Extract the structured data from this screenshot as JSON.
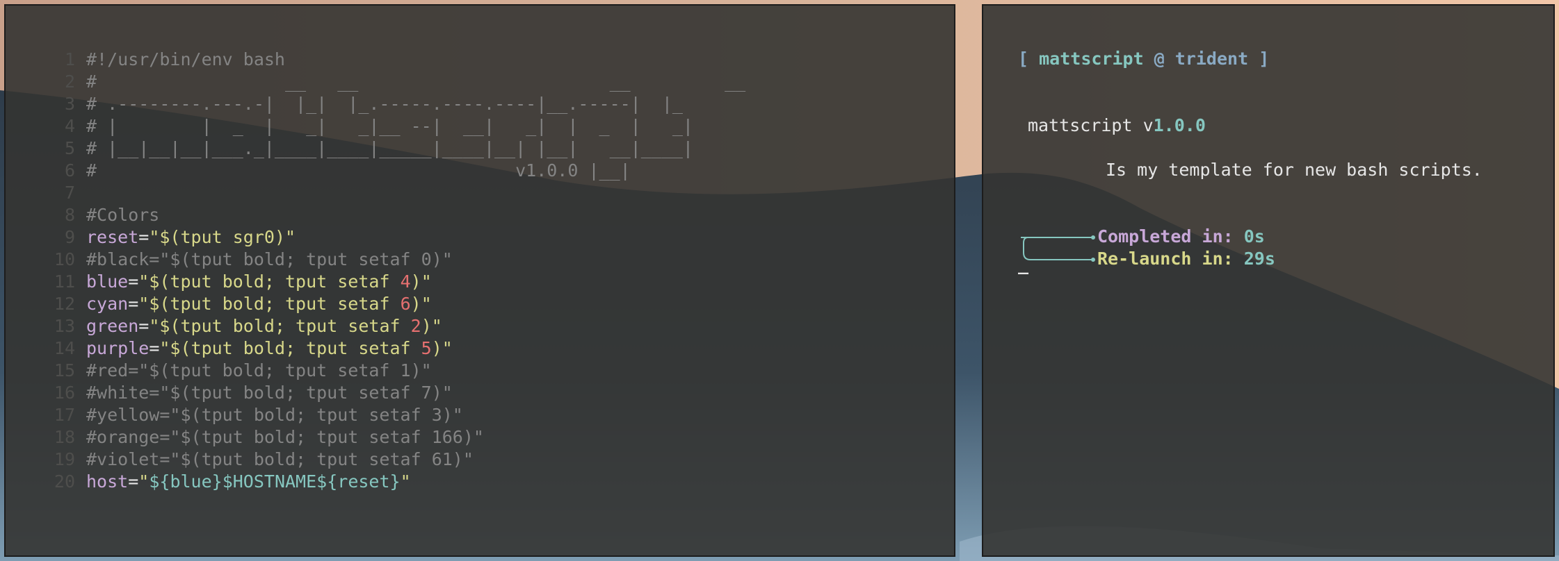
{
  "colors": {
    "terminal_bg": "#343432",
    "comment": "#848484",
    "variable": "#c8a8d8",
    "string": "#d8d88a",
    "number": "#e67070",
    "teal": "#86c7c0",
    "bracket": "#8aaac4",
    "text": "#e6e6e6"
  },
  "editor": {
    "lines": [
      {
        "n": "1",
        "segs": [
          {
            "t": "#!/usr/bin/env bash",
            "c": "com"
          }
        ]
      },
      {
        "n": "2",
        "segs": [
          {
            "t": "#                  __   __                        __         __",
            "c": "com"
          }
        ]
      },
      {
        "n": "3",
        "segs": [
          {
            "t": "# .--------.---.-|  |_|  |_.-----.----.----|__.-----|  |_",
            "c": "com"
          }
        ]
      },
      {
        "n": "4",
        "segs": [
          {
            "t": "# |        |  _  |   _|   _|__ --|  __|   _|  |  _  |   _|",
            "c": "com"
          }
        ]
      },
      {
        "n": "5",
        "segs": [
          {
            "t": "# |__|__|__|___._|____|____|_____|____|__| |__|   __|____|",
            "c": "com"
          }
        ]
      },
      {
        "n": "6",
        "segs": [
          {
            "t": "#                                        v1.0.0 |__|",
            "c": "com"
          }
        ]
      },
      {
        "n": "7",
        "segs": []
      },
      {
        "n": "8",
        "segs": [
          {
            "t": "#Colors",
            "c": "com"
          }
        ]
      },
      {
        "n": "9",
        "segs": [
          {
            "t": "reset",
            "c": "var"
          },
          {
            "t": "=",
            "c": "txt"
          },
          {
            "t": "\"$(tput sgr0)\"",
            "c": "str"
          }
        ]
      },
      {
        "n": "10",
        "segs": [
          {
            "t": "#black=\"$(tput bold; tput setaf 0)\"",
            "c": "com"
          }
        ]
      },
      {
        "n": "11",
        "segs": [
          {
            "t": "blue",
            "c": "var"
          },
          {
            "t": "=",
            "c": "txt"
          },
          {
            "t": "\"$(tput bold; tput setaf ",
            "c": "str"
          },
          {
            "t": "4",
            "c": "num"
          },
          {
            "t": ")\"",
            "c": "str"
          }
        ]
      },
      {
        "n": "12",
        "segs": [
          {
            "t": "cyan",
            "c": "var"
          },
          {
            "t": "=",
            "c": "txt"
          },
          {
            "t": "\"$(tput bold; tput setaf ",
            "c": "str"
          },
          {
            "t": "6",
            "c": "num"
          },
          {
            "t": ")\"",
            "c": "str"
          }
        ]
      },
      {
        "n": "13",
        "segs": [
          {
            "t": "green",
            "c": "var"
          },
          {
            "t": "=",
            "c": "txt"
          },
          {
            "t": "\"$(tput bold; tput setaf ",
            "c": "str"
          },
          {
            "t": "2",
            "c": "num"
          },
          {
            "t": ")\"",
            "c": "str"
          }
        ]
      },
      {
        "n": "14",
        "segs": [
          {
            "t": "purple",
            "c": "var"
          },
          {
            "t": "=",
            "c": "txt"
          },
          {
            "t": "\"$(tput bold; tput setaf ",
            "c": "str"
          },
          {
            "t": "5",
            "c": "num"
          },
          {
            "t": ")\"",
            "c": "str"
          }
        ]
      },
      {
        "n": "15",
        "segs": [
          {
            "t": "#red=\"$(tput bold; tput setaf 1)\"",
            "c": "com"
          }
        ]
      },
      {
        "n": "16",
        "segs": [
          {
            "t": "#white=\"$(tput bold; tput setaf 7)\"",
            "c": "com"
          }
        ]
      },
      {
        "n": "17",
        "segs": [
          {
            "t": "#yellow=\"$(tput bold; tput setaf 3)\"",
            "c": "com"
          }
        ]
      },
      {
        "n": "18",
        "segs": [
          {
            "t": "#orange=\"$(tput bold; tput setaf 166)\"",
            "c": "com"
          }
        ]
      },
      {
        "n": "19",
        "segs": [
          {
            "t": "#violet=\"$(tput bold; tput setaf 61)\"",
            "c": "com"
          }
        ]
      },
      {
        "n": "20",
        "segs": [
          {
            "t": "host",
            "c": "var"
          },
          {
            "t": "=",
            "c": "txt"
          },
          {
            "t": "\"",
            "c": "str"
          },
          {
            "t": "${blue}$HOSTNAME${reset}",
            "c": "tpl"
          },
          {
            "t": "\"",
            "c": "str"
          }
        ]
      }
    ]
  },
  "output": {
    "prompt_open": "[ ",
    "prompt_user": "mattscript",
    "prompt_at": " @ ",
    "prompt_host": "trident",
    "prompt_close": " ]",
    "name_prefix": "mattscript v",
    "version": "1.0.0",
    "description": "Is my template for new bash scripts.",
    "completed_label": "Completed in:",
    "completed_value": "0s",
    "relaunch_label": "Re-launch in:",
    "relaunch_value": "29s",
    "cursor": "_"
  }
}
